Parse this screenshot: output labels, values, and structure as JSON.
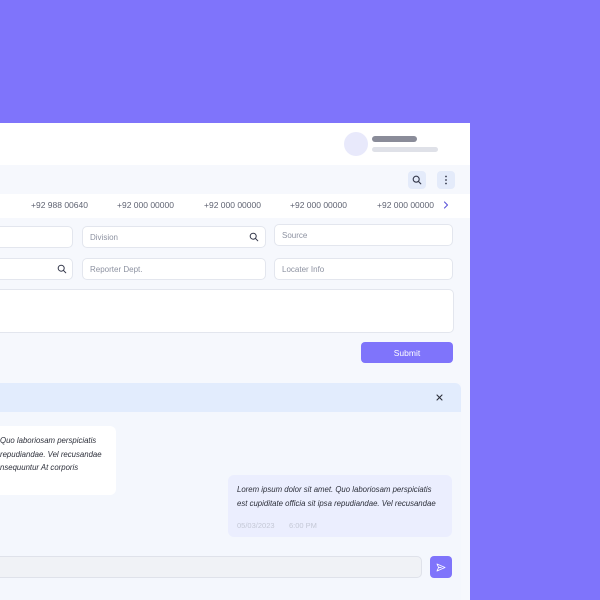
{
  "phone_strip": {
    "numbers": [
      "+92 988 00640",
      "+92 000 00000",
      "+92 000 00000",
      "+92 000 00000",
      "+92 000 00000"
    ]
  },
  "form": {
    "division_placeholder": "Division",
    "source_placeholder": "Source",
    "reporter_dept_placeholder": "Reporter Dept.",
    "locater_info_placeholder": "Locater Info",
    "submit_label": "Submit"
  },
  "chat": {
    "incoming": {
      "lines": [
        "Quo laboriosam perspiciatis",
        "repudiandae. Vel recusandae",
        "nsequuntur At corporis"
      ]
    },
    "outgoing": {
      "lines": [
        "Lorem ipsum dolor sit amet. Quo laboriosam perspiciatis",
        "est cupiditate officia sit ipsa repudiandae. Vel recusandae"
      ],
      "date": "05/03/2023",
      "time": "6:00 PM"
    },
    "close_label": "×"
  },
  "colors": {
    "accent": "#7f74fb",
    "page_background": "#7f74fb"
  },
  "icons": {
    "search": "search-icon",
    "more": "more-vertical-icon",
    "chevron": "chevron-right-icon",
    "send": "send-icon"
  }
}
